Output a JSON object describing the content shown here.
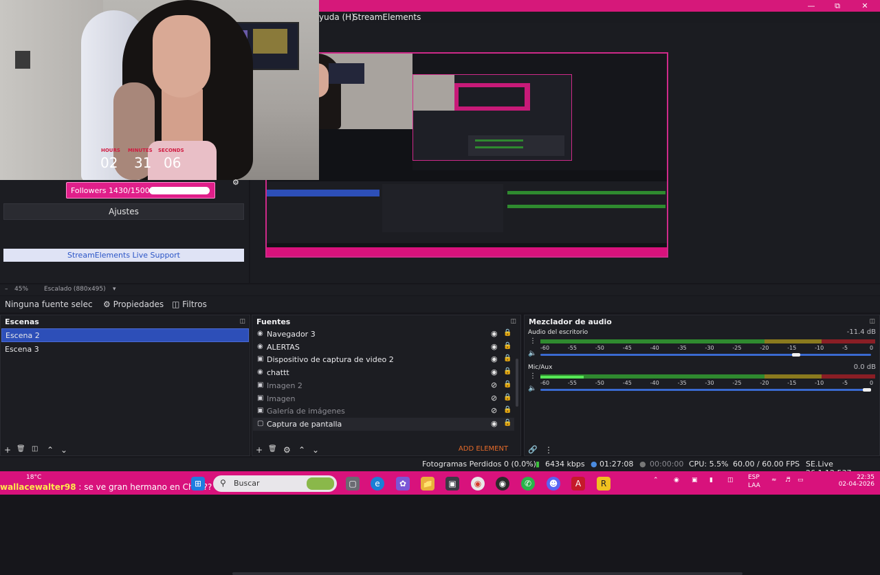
{
  "menubar": {
    "help": "yuda (H)",
    "streamelements": "StreamElements"
  },
  "overlay": {
    "timer_labels": [
      "HOURS",
      "MINUTES",
      "SECONDS"
    ],
    "timer_values": [
      "02",
      "31",
      "06"
    ],
    "followers": "Followers 1430/1500",
    "followers_progress": 0.953
  },
  "controls": {
    "ajustes": "Ajustes",
    "live_support": "StreamElements Live Support"
  },
  "zoom": {
    "level": "45%",
    "scale": "Escalado (880x495)"
  },
  "source_bar": {
    "none_selected": "Ninguna fuente selec",
    "properties": "Propiedades",
    "filters": "Filtros"
  },
  "scenes": {
    "title": "Escenas",
    "items": [
      {
        "label": "Escena 2",
        "selected": true
      },
      {
        "label": "Escena 3",
        "selected": false
      }
    ]
  },
  "sources": {
    "title": "Fuentes",
    "items": [
      {
        "label": "Navegador 3",
        "visible": true
      },
      {
        "label": "ALERTAS",
        "visible": true
      },
      {
        "label": "Dispositivo de captura de video 2",
        "visible": true
      },
      {
        "label": "chattt",
        "visible": true
      },
      {
        "label": "Imagen 2",
        "visible": false
      },
      {
        "label": "Imagen",
        "visible": false
      },
      {
        "label": "Galería de imágenes",
        "visible": false
      },
      {
        "label": "Captura de pantalla",
        "visible": true
      }
    ],
    "add_element": "ADD ELEMENT"
  },
  "mixer": {
    "title": "Mezclador de audio",
    "ticks": [
      "-60",
      "-55",
      "-50",
      "-45",
      "-40",
      "-35",
      "-30",
      "-25",
      "-20",
      "-15",
      "-10",
      "-5",
      "0"
    ],
    "channels": [
      {
        "name": "Audio del escritorio",
        "db": "-11.4 dB",
        "level": 0.0,
        "volume": 0.78
      },
      {
        "name": "Mic/Aux",
        "db": "0.0 dB",
        "level": 0.13,
        "volume": 1.0
      }
    ]
  },
  "status": {
    "dropped": "Fotogramas Perdidos 0 (0.0%)",
    "bitrate": "6434 kbps",
    "live_time": "01:27:08",
    "rec_time": "00:00:00",
    "cpu": "CPU: 5.5%",
    "fps": "60.00 / 60.00 FPS",
    "version": "SE.Live 26.1.12.537"
  },
  "taskbar": {
    "weather": "18°C",
    "chat_user": "wallacewalter98",
    "chat_msg": " : se ve gran hermano en Chile??",
    "search": "Buscar",
    "lang": "ESP",
    "lang2": "LAA",
    "time": "22:35",
    "date": "02-04-2026"
  },
  "colors": {
    "accent": "#d6187a",
    "selection": "#2d4fb8",
    "add_element": "#e66b2a"
  }
}
